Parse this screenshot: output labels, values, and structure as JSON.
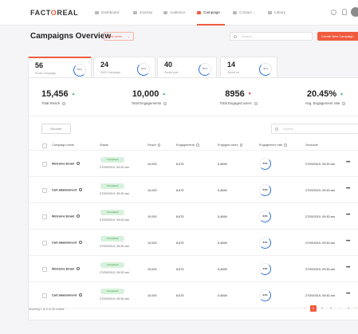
{
  "brand": {
    "logo_prefix": "FACT",
    "logo_o": "O",
    "logo_suffix": "REAL"
  },
  "nav": {
    "items": [
      {
        "label": "Dashboard",
        "icon": "dashboard-icon"
      },
      {
        "label": "Journey",
        "icon": "journey-icon"
      },
      {
        "label": "Audience",
        "icon": "audience-icon"
      },
      {
        "label": "Campaign",
        "icon": "campaign-icon",
        "active": true
      },
      {
        "label": "Contact ⌄",
        "icon": "contact-icon"
      },
      {
        "label": "Library",
        "icon": "library-icon"
      }
    ]
  },
  "header": {
    "title": "Campaigns Overview",
    "date_filter": "Last week",
    "search_placeholder": "Search",
    "create_button": "Create New Campaign"
  },
  "tabs": [
    {
      "count": "56",
      "label": "Email Campaign",
      "percent": "80%"
    },
    {
      "count": "24",
      "label": "SMS Campaign",
      "percent": "60%"
    },
    {
      "count": "40",
      "label": "Social post",
      "percent": "50%"
    },
    {
      "count": "14",
      "label": "Social ad",
      "percent": "40%"
    }
  ],
  "stats": [
    {
      "value": "15,456",
      "trend": "▲",
      "label": "Total Reach"
    },
    {
      "value": "10,000",
      "trend": "▲",
      "label": "Total Engagements"
    },
    {
      "value": "8956",
      "trend": "▼",
      "label": "Total Engaged users"
    },
    {
      "value": "20.45%",
      "trend": "▲",
      "label": "Avg. Engagement rate"
    }
  ],
  "table": {
    "reorder_label": "Reorder",
    "search_placeholder": "Search",
    "headers": {
      "name": "Campaign name",
      "status": "Status",
      "reach": "Reach",
      "engagements": "Engagements",
      "engaged_users": "Engaged users",
      "engagement_rate": "Engagement rate",
      "schedule": "Schedule"
    },
    "rows": [
      {
        "name": "Welcome Email",
        "status": "Completed",
        "date": "27/09/2019, 09:30 am",
        "reach": "10,000",
        "engagements": "8,675",
        "engaged_users": "5,4698",
        "rate": "34%",
        "schedule": "27/09/2019, 09:30 am",
        "more": "•••"
      },
      {
        "name": "Cart abadonment",
        "status": "Completed",
        "date": "27/09/2019, 09:30 am",
        "reach": "10,000",
        "engagements": "8,675",
        "engaged_users": "5,4698",
        "rate": "34%",
        "schedule": "27/09/2019, 09:30 am",
        "more": "•••"
      },
      {
        "name": "Welcome Email",
        "status": "Completed",
        "date": "27/09/2019, 09:30 am",
        "reach": "10,000",
        "engagements": "8,675",
        "engaged_users": "5,4698",
        "rate": "34%",
        "schedule": "27/09/2019, 09:30 am",
        "more": "•••"
      },
      {
        "name": "Cart abadonment",
        "status": "Completed",
        "date": "27/09/2019, 09:30 am",
        "reach": "10,000",
        "engagements": "8,675",
        "engaged_users": "5,4698",
        "rate": "34%",
        "schedule": "27/09/2019, 09:30 am",
        "more": "•••"
      },
      {
        "name": "Welcome Email",
        "status": "Completed",
        "date": "27/09/2019, 09:30 am",
        "reach": "10,000",
        "engagements": "8,675",
        "engaged_users": "5,4698",
        "rate": "34%",
        "schedule": "27/09/2019, 09:30 am",
        "more": "•••"
      },
      {
        "name": "Cart abadonment",
        "status": "Completed",
        "date": "27/09/2019, 09:30 am",
        "reach": "10,000",
        "engagements": "8,675",
        "engaged_users": "5,4698",
        "rate": "34%",
        "schedule": "27/09/2019, 09:30 am",
        "more": "•••"
      }
    ],
    "footer_text": "Showing 1 to 5 of 40 entries",
    "pagination": [
      "‹",
      "1",
      "2",
      "3",
      "…",
      "4",
      "›"
    ]
  }
}
